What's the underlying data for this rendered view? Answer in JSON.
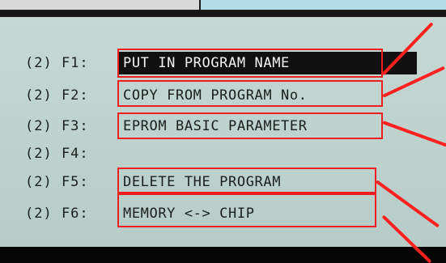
{
  "menu": {
    "items": [
      {
        "key": "(2) F1:",
        "label": "PUT IN PROGRAM NAME"
      },
      {
        "key": "(2) F2:",
        "label": "COPY FROM PROGRAM No."
      },
      {
        "key": "(2) F3:",
        "label": "EPROM BASIC PARAMETER"
      },
      {
        "key": "(2) F4:",
        "label": ""
      },
      {
        "key": "(2) F5:",
        "label": "DELETE THE PROGRAM"
      },
      {
        "key": "(2) F6:",
        "label": "MEMORY <-> CHIP"
      }
    ],
    "selected_item": "PUT IN PROGRAM NAME"
  },
  "annotations": {
    "color": "#ef1f1f"
  }
}
